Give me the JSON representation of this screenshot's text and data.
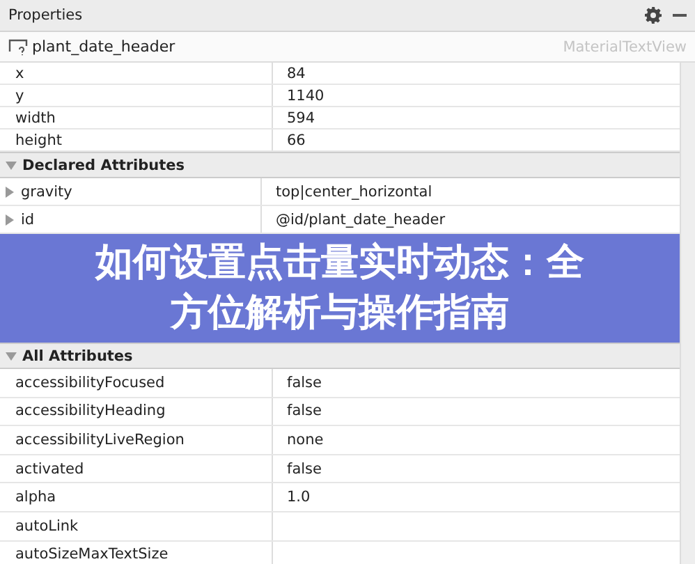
{
  "panel": {
    "title": "Properties"
  },
  "component": {
    "name": "plant_date_header",
    "class": "MaterialTextView"
  },
  "position_rows": [
    {
      "name": "x",
      "value": "84"
    },
    {
      "name": "y",
      "value": "1140"
    },
    {
      "name": "width",
      "value": "594"
    },
    {
      "name": "height",
      "value": "66"
    }
  ],
  "sections": [
    {
      "title": "Declared Attributes",
      "expanded": true,
      "rows": [
        {
          "name": "gravity",
          "value": "top|center_horizontal",
          "expanded": false
        },
        {
          "name": "id",
          "value": "@id/plant_date_header",
          "expanded": false
        }
      ]
    },
    {
      "title": "All Attributes",
      "expanded": true,
      "rows": [
        {
          "name": "accessibilityFocused",
          "value": "false"
        },
        {
          "name": "accessibilityHeading",
          "value": "false"
        },
        {
          "name": "accessibilityLiveRegion",
          "value": "none"
        },
        {
          "name": "activated",
          "value": "false"
        },
        {
          "name": "alpha",
          "value": "1.0"
        },
        {
          "name": "autoLink"
        },
        {
          "name": "autoSizeMaxTextSize"
        }
      ]
    }
  ],
  "banner": {
    "title": "如何设置点击量实时动态：全方位解析与操作指南"
  }
}
